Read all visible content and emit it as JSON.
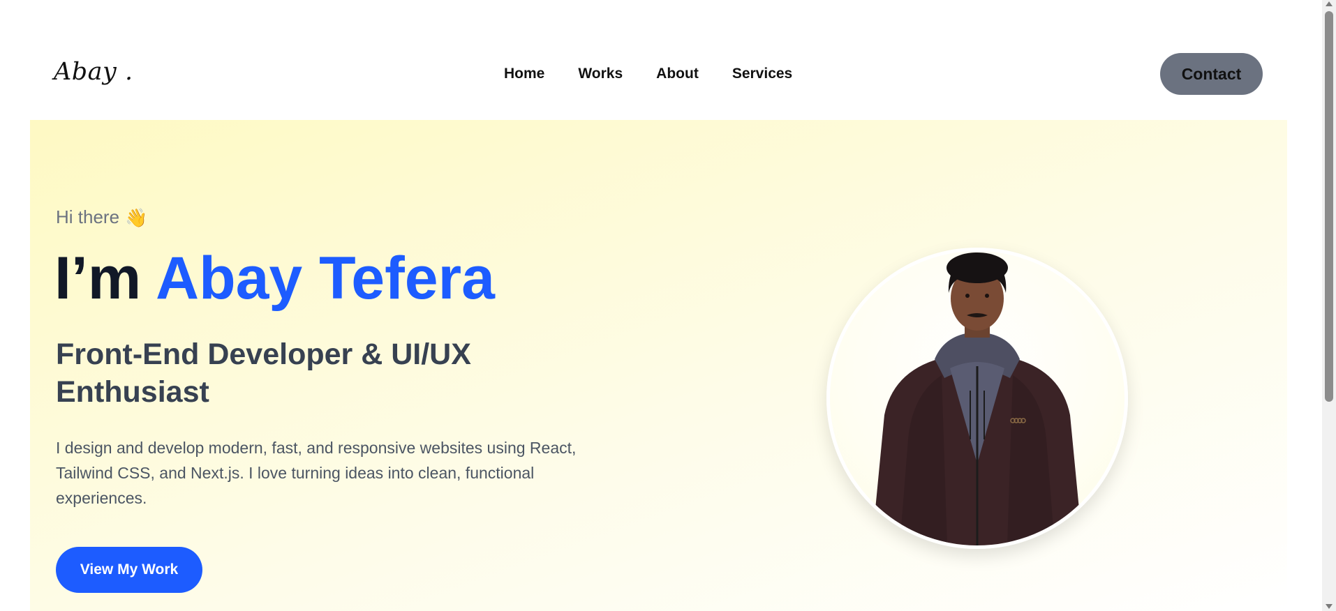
{
  "header": {
    "logo": "Abay .",
    "nav": [
      "Home",
      "Works",
      "About",
      "Services"
    ],
    "contact_label": "Contact"
  },
  "hero": {
    "greeting": "Hi there",
    "greeting_emoji": "👋",
    "headline_prefix": "I’m",
    "headline_name": "Abay Tefera",
    "role": "Front-End Developer & UI/UX Enthusiast",
    "description": "I design and develop modern, fast, and responsive websites using React, Tailwind CSS, and Next.js. I love turning ideas into clean, functional experiences.",
    "cta_label": "View My Work"
  },
  "colors": {
    "accent": "#1d5cff",
    "contact_button": "#6b7280",
    "hero_background": "#fef9c3"
  }
}
